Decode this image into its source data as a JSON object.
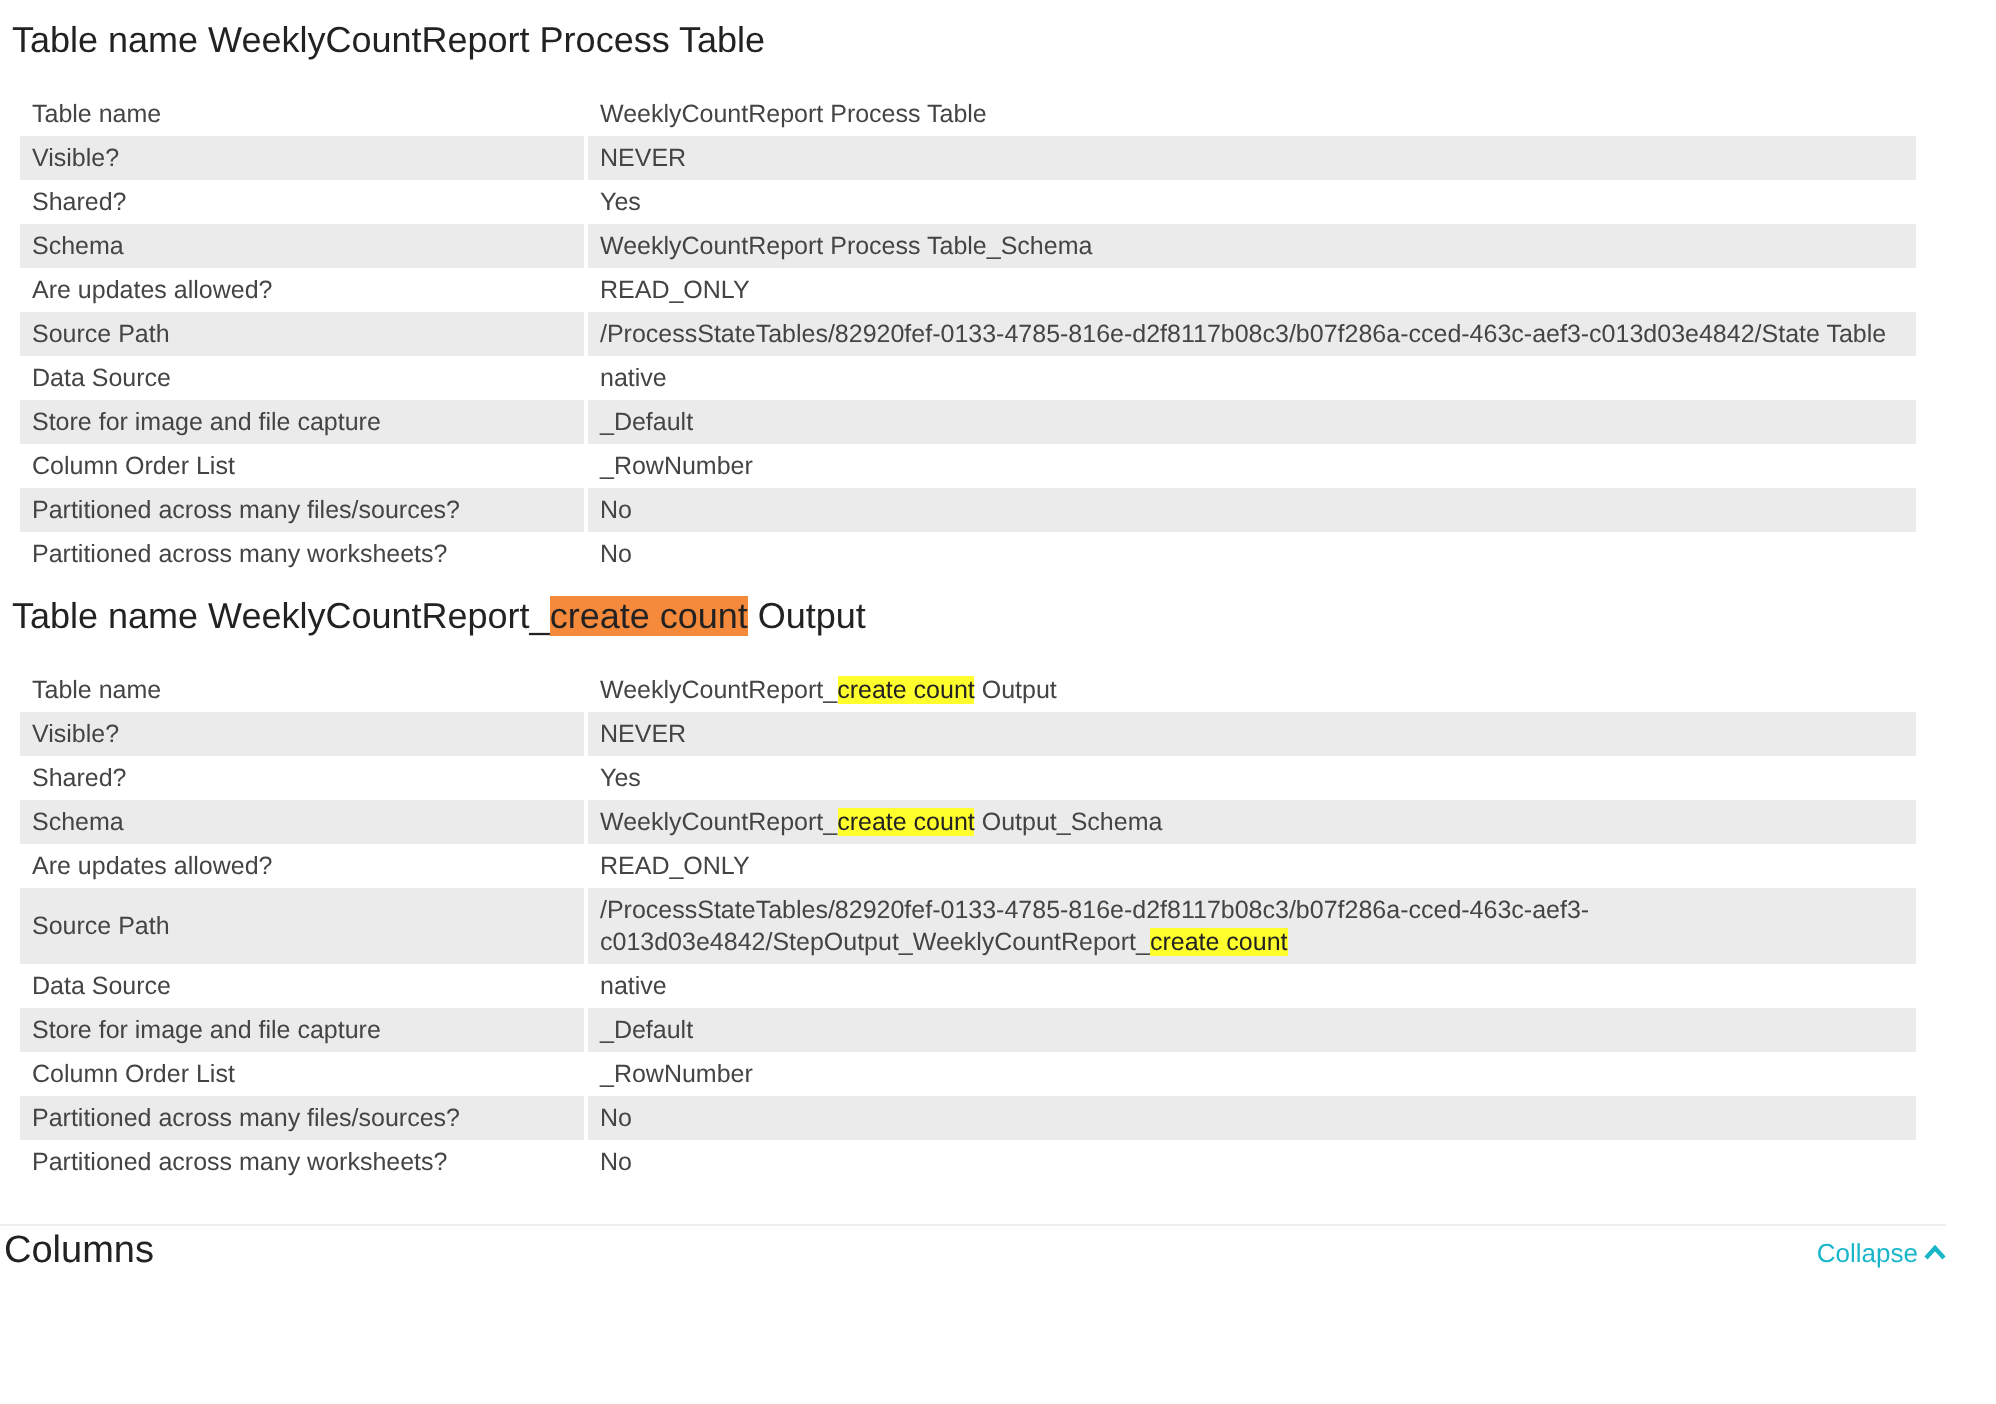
{
  "tables": [
    {
      "title": "Table name WeeklyCountReport Process Table",
      "rows": [
        {
          "label": "Table name",
          "value": "WeeklyCountReport Process Table"
        },
        {
          "label": "Visible?",
          "value": "NEVER"
        },
        {
          "label": "Shared?",
          "value": "Yes"
        },
        {
          "label": "Schema",
          "value": "WeeklyCountReport Process Table_Schema"
        },
        {
          "label": "Are updates allowed?",
          "value": "READ_ONLY"
        },
        {
          "label": "Source Path",
          "value": "/ProcessStateTables/82920fef-0133-4785-816e-d2f8117b08c3/b07f286a-cced-463c-aef3-c013d03e4842/State Table"
        },
        {
          "label": "Data Source",
          "value": "native"
        },
        {
          "label": "Store for image and file capture",
          "value": "_Default"
        },
        {
          "label": "Column Order List",
          "value": "_RowNumber"
        },
        {
          "label": "Partitioned across many files/sources?",
          "value": "No"
        },
        {
          "label": "Partitioned across many worksheets?",
          "value": "No"
        }
      ]
    },
    {
      "title": "Table name WeeklyCountReport_**create count** Output",
      "rows": [
        {
          "label": "Table name",
          "value": "WeeklyCountReport_**create count** Output"
        },
        {
          "label": "Visible?",
          "value": "NEVER"
        },
        {
          "label": "Shared?",
          "value": "Yes"
        },
        {
          "label": "Schema",
          "value": "WeeklyCountReport_**create count** Output_Schema"
        },
        {
          "label": "Are updates allowed?",
          "value": "READ_ONLY"
        },
        {
          "label": "Source Path",
          "value": "/ProcessStateTables/82920fef-0133-4785-816e-d2f8117b08c3/b07f286a-cced-463c-aef3-c013d03e4842/StepOutput_WeeklyCountReport_**create count**"
        },
        {
          "label": "Data Source",
          "value": "native"
        },
        {
          "label": "Store for image and file capture",
          "value": "_Default"
        },
        {
          "label": "Column Order List",
          "value": "_RowNumber"
        },
        {
          "label": "Partitioned across many files/sources?",
          "value": "No"
        },
        {
          "label": "Partitioned across many worksheets?",
          "value": "No"
        }
      ]
    }
  ],
  "columns_section": {
    "title": "Columns",
    "toggle": "Collapse"
  }
}
